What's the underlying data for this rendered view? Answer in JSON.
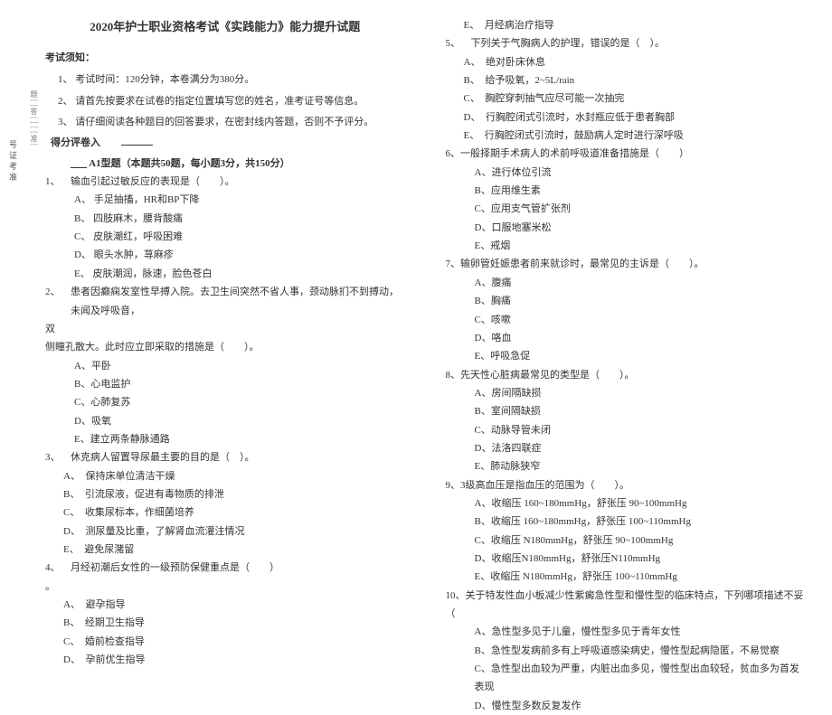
{
  "title": "2020年护士职业资格考试《实践能力》能力提升试题",
  "notice_head": "考试须知：",
  "instructions": [
    "1、 考试时间：120分钟，本卷满分为380分。",
    "2、 请首先按要求在试卷的指定位置填写您的姓名，准考证号等信息。",
    "3、 请仔细阅读各种题目的回答要求，在密封线内答题，否则不予评分。"
  ],
  "score_head": "得分评卷入",
  "a1_head": "A1型题（本题共50题，每小题3分，共150分）",
  "vertical_label": "号证考准",
  "q1": {
    "num": "1、",
    "stem": "输血引起过敏反应的表现是（　　）。",
    "opts": [
      "A、 手足抽搐，HR和BP下降",
      "B、 四肢麻木，腰背酸痛",
      "C、 皮肤潮红，呼吸困难",
      "D、 眼头水肿，荨麻疹",
      "E、 皮肤潮润，脉速，脸色苍白"
    ]
  },
  "q2": {
    "num": "2、",
    "stem_a": "患者因癫痫发室性早搏入院。去卫生间突然不省人事，颈动脉扪不到搏动，未闻及呼吸音，",
    "stem_b": "双",
    "stem_c": "侧瞳孔散大。此时应立即采取的措施是（　　）。",
    "opts": [
      "A、平卧",
      "B、心电监护",
      "C、心肺复苏",
      "D、吸氧",
      "E、建立两条静脉通路"
    ]
  },
  "q3": {
    "num": "3、",
    "stem": "休克病人留置导尿最主要的目的是（　）。",
    "opts": [
      "A、　保持床单位清洁干燥",
      "B、　引流尿液，促进有毒物质的排泄",
      "C、　收集尿标本，作细菌培养",
      "D、　测尿量及比重，了解肾血流灌注情况",
      "E、　避免尿潴留"
    ]
  },
  "q4": {
    "num": "4、",
    "stem": "月经初潮后女性的一级预防保健重点是（　　）",
    "tail": "。",
    "opts": [
      "A、　避孕指导",
      "B、　经期卫生指导",
      "C、　婚前检查指导",
      "D、　孕前优生指导"
    ]
  },
  "q4e": "E、　月经病治疗指导",
  "q5": {
    "num": "5、",
    "stem": "下列关于气胸病人的护理，错误的是（　）。",
    "opts": [
      "A、　绝对卧床休息",
      "B、　给予吸氧，2~5L/rain",
      "C、　胸腔穿刺抽气应尽可能一次抽完",
      "D、　行胸腔闭式引流时，水封瓶应低于患者胸部",
      "E、　行胸腔闭式引流时，鼓励病人定时进行深呼吸"
    ]
  },
  "q6": {
    "num": "6、",
    "stem": "一般择期手术病人的术前呼吸道准备措施是（　　）",
    "opts": [
      "A、进行体位引流",
      "B、应用维生素",
      "C、应用支气管扩张剂",
      "D、口服地塞米松",
      "E、戒烟"
    ]
  },
  "q7": {
    "num": "7、",
    "stem": "输卵管妊娠患者前来就诊时，最常见的主诉是（　　）。",
    "opts": [
      "A、腹痛",
      "B、胸痛",
      "C、咳嗽",
      "D、咯血",
      "E、呼吸急促"
    ]
  },
  "q8": {
    "num": "8、",
    "stem": "先天性心脏病最常见的类型是（　　）。",
    "opts": [
      "A、房间隔缺损",
      "B、室间隔缺损",
      "C、动脉导管未闭",
      "D、法洛四联症",
      "E、肺动脉狭窄"
    ]
  },
  "q9": {
    "num": "9、",
    "stem": "3级高血压是指血压的范围为（　　）。",
    "opts": [
      "A、收缩压 160~180mmHg，舒张压 90~100mmHg",
      "B、收缩压 160~180mmHg，舒张压 100~110mmHg",
      "C、收缩压 N180mmHg，舒张压 90~100mmHg",
      "D、收缩压N180mmHg，舒张压N110mmHg",
      "E、收缩压 N180mmHg，舒张压 100~110mmHg"
    ]
  },
  "q10": {
    "num": "10、",
    "stem": "关于特发性血小板减少性紫癜急性型和慢性型的临床特点，下列哪项描述不妥（",
    "opts": [
      "A、急性型多见于儿童，慢性型多见于青年女性",
      "B、急性型发病前多有上呼吸道感染病史，慢性型起病隐匿，不易觉察",
      "C、急性型出血较为严重，内脏出血多见，慢性型出血较轻，贫血多为首发表现",
      "D、慢性型多数反复发作"
    ]
  }
}
